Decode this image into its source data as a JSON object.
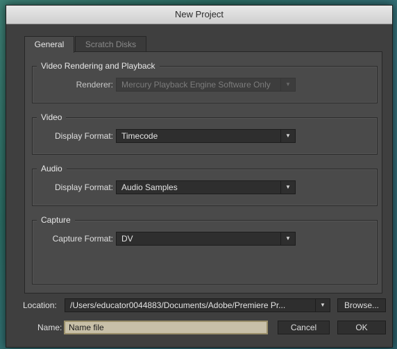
{
  "window": {
    "title": "New Project"
  },
  "tabs": [
    {
      "label": "General",
      "active": true
    },
    {
      "label": "Scratch Disks",
      "active": false
    }
  ],
  "groups": {
    "video_rendering": {
      "title": "Video Rendering and Playback",
      "renderer_label": "Renderer:",
      "renderer_value": "Mercury Playback Engine Software Only"
    },
    "video": {
      "title": "Video",
      "format_label": "Display Format:",
      "format_value": "Timecode"
    },
    "audio": {
      "title": "Audio",
      "format_label": "Display Format:",
      "format_value": "Audio Samples"
    },
    "capture": {
      "title": "Capture",
      "format_label": "Capture Format:",
      "format_value": "DV"
    }
  },
  "location": {
    "label": "Location:",
    "value": "/Users/educator0044883/Documents/Adobe/Premiere Pr...",
    "browse_label": "Browse..."
  },
  "name": {
    "label": "Name:",
    "value": "Name file"
  },
  "buttons": {
    "cancel": "Cancel",
    "ok": "OK"
  },
  "icons": {
    "dropdown": "chevron-down-icon"
  },
  "colors": {
    "panel": "#4a4a4a",
    "input_highlight": "#c8c0a8"
  }
}
